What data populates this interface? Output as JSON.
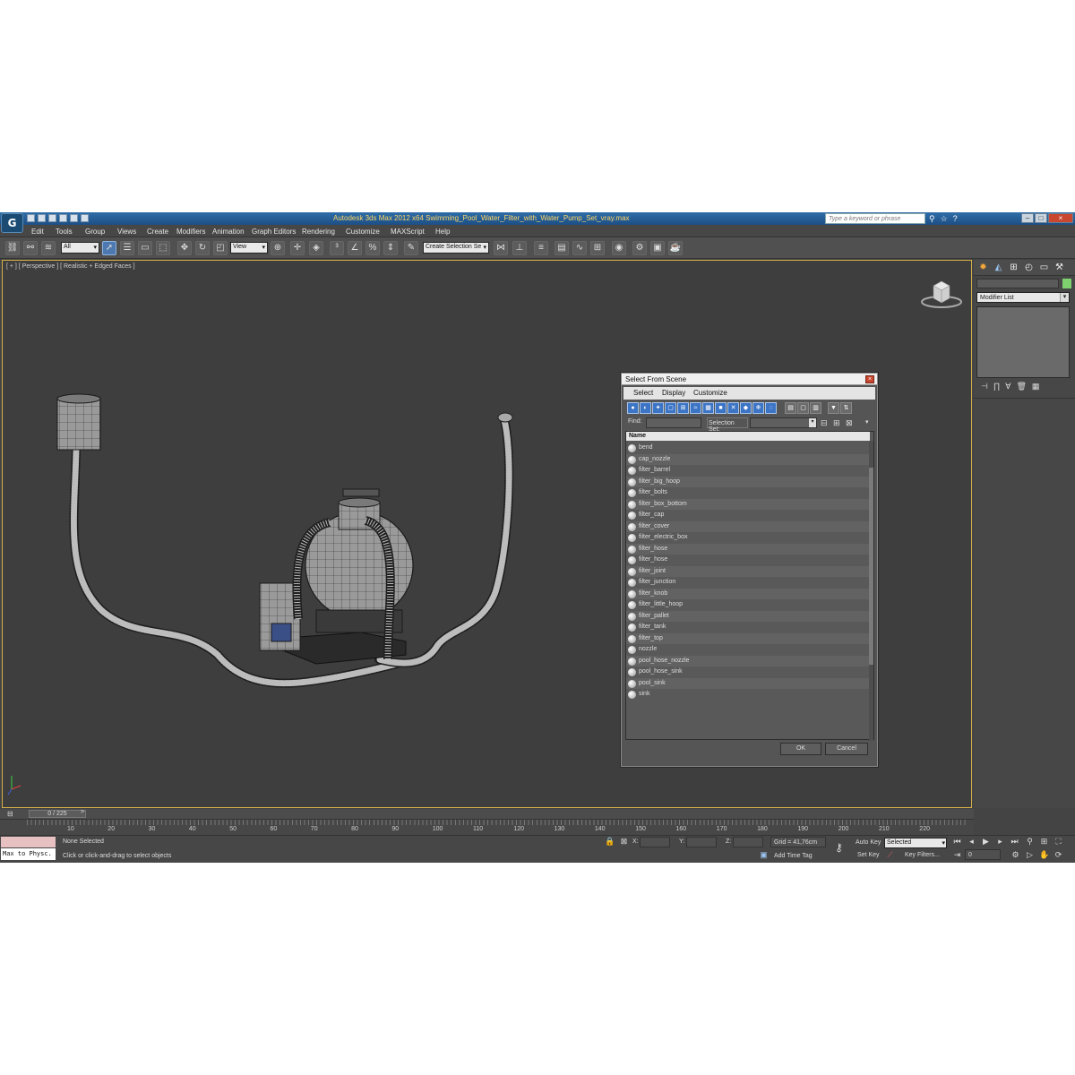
{
  "titlebar": {
    "title": "Autodesk 3ds Max  2012 x64     Swimming_Pool_Water_Filter_with_Water_Pump_Set_vray.max",
    "search_placeholder": "Type a keyword or phrase",
    "icons": [
      "binoculars-icon",
      "star-icon",
      "help-icon"
    ]
  },
  "menu": [
    "Edit",
    "Tools",
    "Group",
    "Views",
    "Create",
    "Modifiers",
    "Animation",
    "Graph Editors",
    "Rendering",
    "Customize",
    "MAXScript",
    "Help"
  ],
  "toolbar": {
    "selection_filter": "All",
    "reference_coord": "View",
    "named_selection": "Create Selection Se"
  },
  "viewport": {
    "label": "[ + ] [ Perspective ] [ Realistic + Edged Faces ]"
  },
  "command_panel": {
    "modifier_list": "Modifier List"
  },
  "dialog": {
    "title": "Select From Scene",
    "menu": [
      "Select",
      "Display",
      "Customize"
    ],
    "find_label": "Find:",
    "selection_set_label": "Selection Set:",
    "column_header": "Name",
    "objects": [
      "bend",
      "cap_nozzle",
      "filter_barrel",
      "filter_big_hoop",
      "filter_bolts",
      "filter_box_bottom",
      "filter_cap",
      "filter_cover",
      "filter_electric_box",
      "filter_hose",
      "filter_hose",
      "filter_joint",
      "filter_junction",
      "filter_knob",
      "filter_little_hoop",
      "filter_pallet",
      "filter_tank",
      "filter_top",
      "nozzle",
      "pool_hose_nozzle",
      "pool_hose_sink",
      "pool_sink",
      "sink"
    ],
    "ok_label": "OK",
    "cancel_label": "Cancel"
  },
  "timeline": {
    "frame_display": "0 / 225",
    "ticks": [
      "10",
      "20",
      "30",
      "40",
      "50",
      "60",
      "70",
      "80",
      "90",
      "100",
      "110",
      "120",
      "130",
      "140",
      "150",
      "160",
      "170",
      "180",
      "190",
      "200",
      "210",
      "220"
    ]
  },
  "status": {
    "maxscript_listener": "Max to Physc.",
    "selection_status": "None Selected",
    "prompt": "Click or click-and-drag to select objects",
    "x_label": "X:",
    "y_label": "Y:",
    "z_label": "Z:",
    "grid": "Grid = 41,76cm",
    "add_time_tag": "Add Time Tag",
    "auto_key": "Auto Key",
    "auto_key_mode": "Selected",
    "set_key": "Set Key",
    "key_filters": "Key Filters...",
    "current_frame": "0"
  },
  "colors": {
    "viewport_border": "#d6b04a",
    "object_color": "#7fd16f",
    "accent": "#3c75c6"
  }
}
